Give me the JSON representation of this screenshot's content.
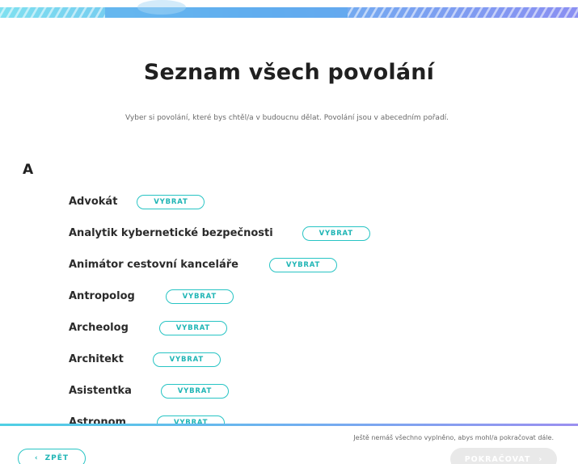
{
  "header": {
    "title": "Seznam všech povolání",
    "subtitle": "Vyber si povolání, které bys chtěl/a v budoucnu dělat. Povolání jsou v abecedním pořadí."
  },
  "section": {
    "letter": "A"
  },
  "professions": [
    {
      "label": "Advokát",
      "button": "VYBRAT"
    },
    {
      "label": "Analytik kybernetické bezpečnosti",
      "button": "VYBRAT"
    },
    {
      "label": "Animátor cestovní kanceláře",
      "button": "VYBRAT"
    },
    {
      "label": "Antropolog",
      "button": "VYBRAT"
    },
    {
      "label": "Archeolog",
      "button": "VYBRAT"
    },
    {
      "label": "Architekt",
      "button": "VYBRAT"
    },
    {
      "label": "Asistentka",
      "button": "VYBRAT"
    },
    {
      "label": "Astronom",
      "button": "VYBRAT"
    }
  ],
  "footer": {
    "note": "Ještě nemáš všechno vyplněno, abys mohl/a pokračovat dále.",
    "back_label": "ZPĚT",
    "back_icon": "chevron-left-icon",
    "back_glyph": "‹",
    "next_label": "POKRAČOVAT",
    "next_icon": "chevron-right-icon",
    "next_glyph": "›"
  },
  "colors": {
    "accent": "#27c4c4",
    "disabled": "#e9e9e9",
    "band_blue": "#5aa9ee"
  }
}
